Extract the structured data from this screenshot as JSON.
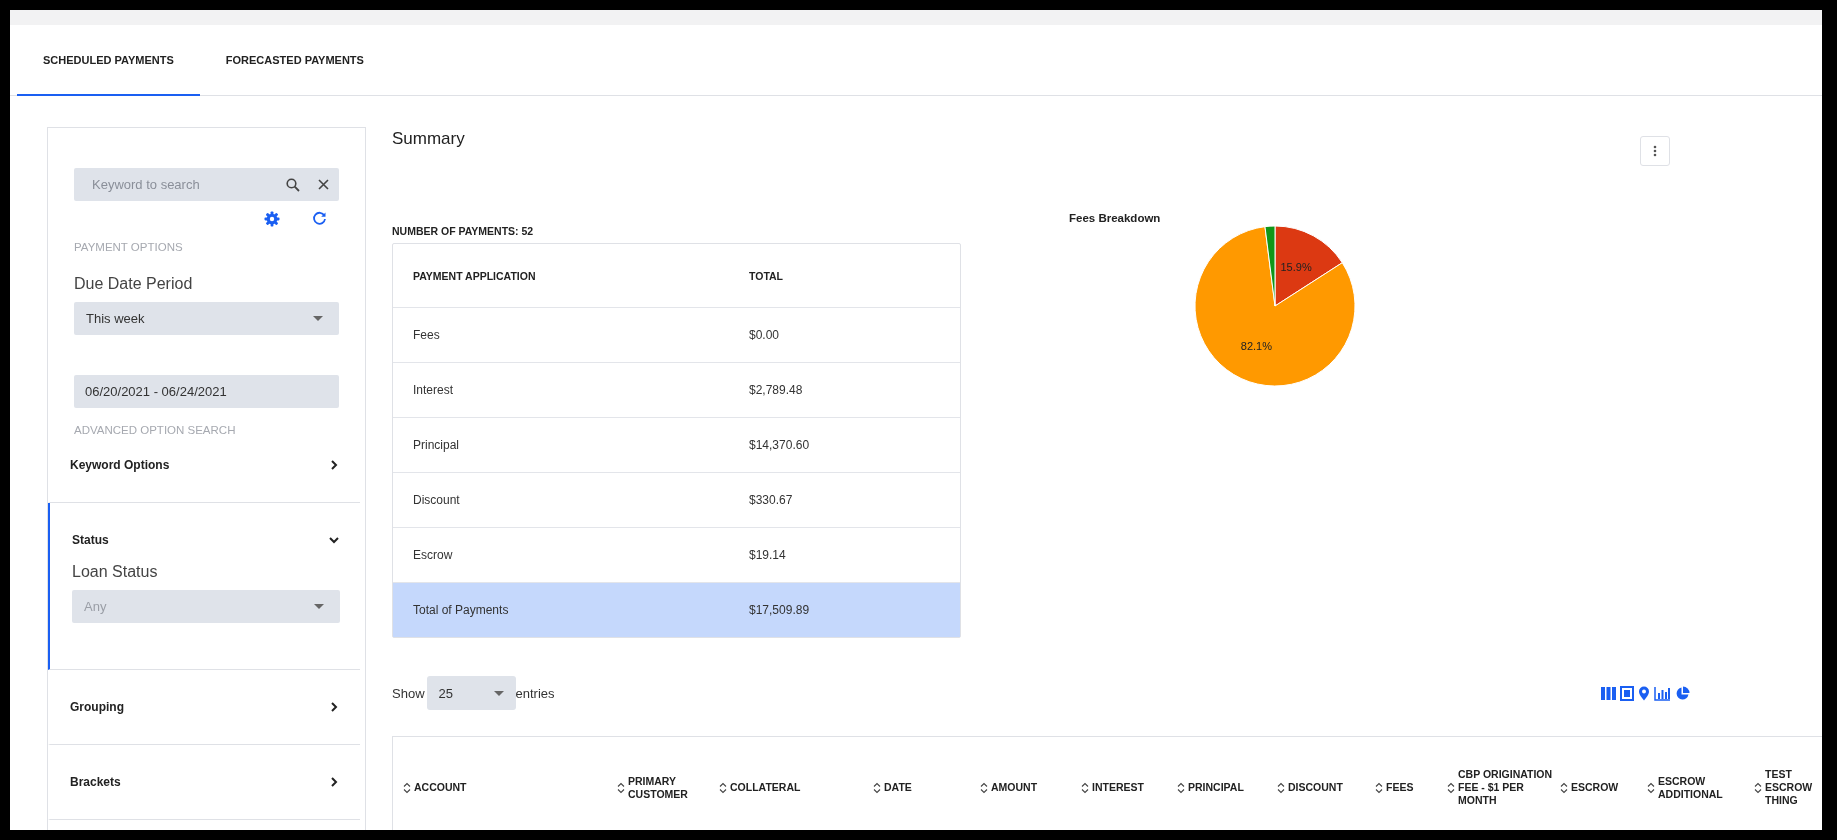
{
  "tabs": [
    {
      "label": "SCHEDULED PAYMENTS",
      "selected": true
    },
    {
      "label": "FORECASTED PAYMENTS",
      "selected": false
    }
  ],
  "filters": {
    "search": {
      "placeholder": "Keyword to search"
    },
    "payment_options_heading": "PAYMENT OPTIONS",
    "due_date": {
      "label": "Due Date Period",
      "value": "This week"
    },
    "date_range": "06/20/2021 - 06/24/2021",
    "advanced_heading": "ADVANCED OPTION SEARCH",
    "sections": [
      {
        "title": "Keyword Options",
        "expanded": false
      },
      {
        "title": "Status",
        "expanded": true,
        "field_label": "Loan Status",
        "field_value": "Any",
        "field_disabled": true
      },
      {
        "title": "Grouping",
        "expanded": false
      },
      {
        "title": "Brackets",
        "expanded": false
      }
    ]
  },
  "summary": {
    "title": "Summary",
    "count_label": "NUMBER OF PAYMENTS: 52",
    "columns": [
      "PAYMENT APPLICATION",
      "TOTAL"
    ],
    "rows": [
      {
        "label": "Fees",
        "total": "$0.00",
        "highlighted": false
      },
      {
        "label": "Interest",
        "total": "$2,789.48",
        "highlighted": false
      },
      {
        "label": "Principal",
        "total": "$14,370.60",
        "highlighted": false
      },
      {
        "label": "Discount",
        "total": "$330.67",
        "highlighted": false
      },
      {
        "label": "Escrow",
        "total": "$19.14",
        "highlighted": false
      },
      {
        "label": "Total of Payments",
        "total": "$17,509.89",
        "highlighted": true
      }
    ]
  },
  "chart": {
    "chart_data": {
      "type": "pie",
      "title": "Fees Breakdown",
      "value_labels": [
        "15.9%",
        "82.1%",
        null
      ],
      "series": [
        {
          "values": [
            15.9,
            82.1,
            2.0
          ],
          "colors": [
            "#dc3912",
            "#ff9900",
            "#109618"
          ]
        }
      ]
    }
  },
  "entries": {
    "prefix": "Show",
    "value": "25",
    "suffix": "entries"
  },
  "payments_table": {
    "columns": [
      "ACCOUNT",
      "PRIMARY CUSTOMER",
      "COLLATERAL",
      "DATE",
      "AMOUNT",
      "INTEREST",
      "PRINCIPAL",
      "DISCOUNT",
      "FEES",
      "CBP ORIGINATION FEE - $1 PER MONTH",
      "ESCROW",
      "ESCROW ADDITIONAL",
      "TEST ESCROW THING"
    ]
  }
}
